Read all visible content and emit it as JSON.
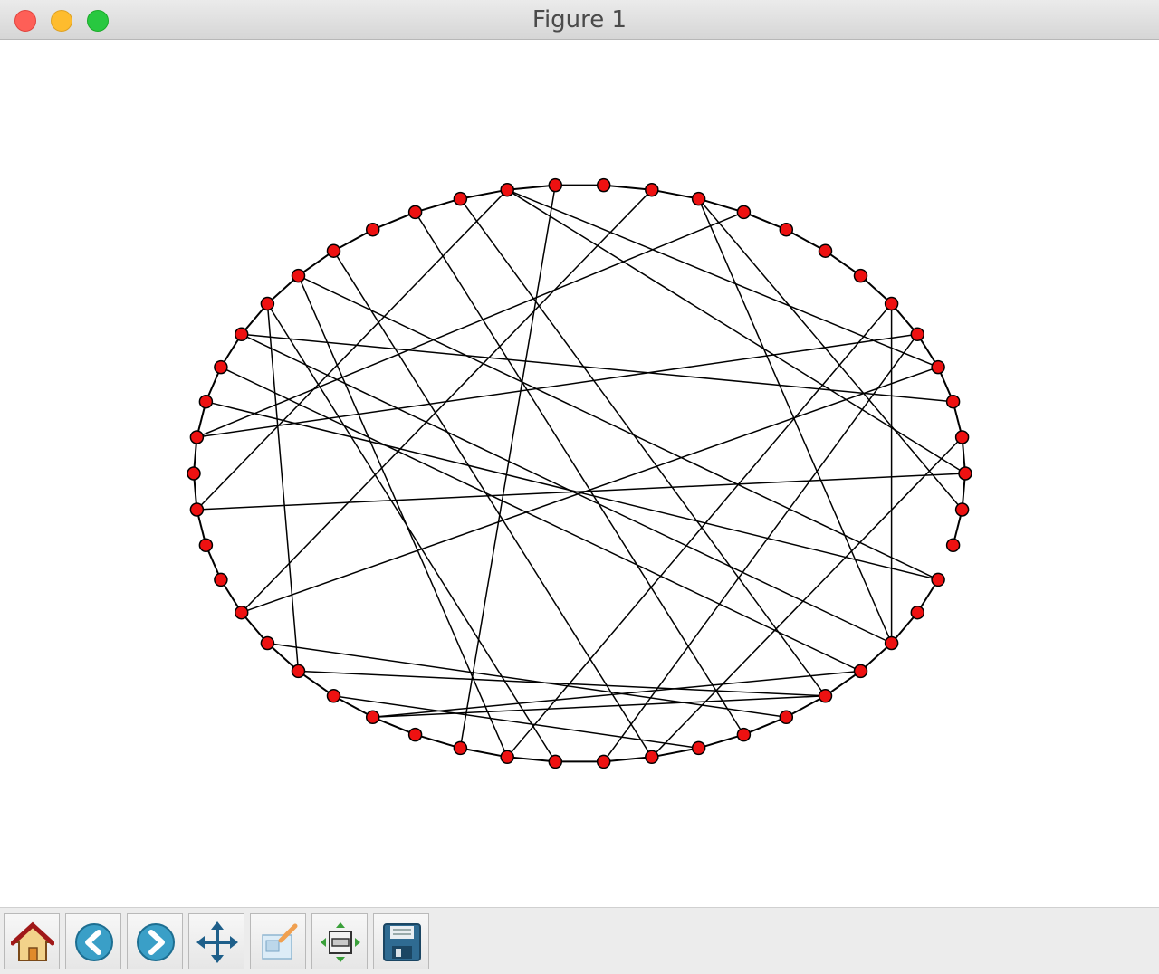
{
  "window": {
    "title": "Figure 1",
    "controls": [
      "close-icon",
      "minimize-icon",
      "maximize-icon"
    ]
  },
  "toolbar": {
    "buttons": [
      {
        "name": "home",
        "icon": "home-icon"
      },
      {
        "name": "back",
        "icon": "back-arrow-icon"
      },
      {
        "name": "forward",
        "icon": "forward-arrow-icon"
      },
      {
        "name": "pan",
        "icon": "pan-arrows-icon"
      },
      {
        "name": "zoom",
        "icon": "zoom-rect-icon"
      },
      {
        "name": "configure-subplots",
        "icon": "subplots-icon"
      },
      {
        "name": "save",
        "icon": "floppy-disk-icon"
      }
    ]
  },
  "colors": {
    "node_fill": "#ee1111",
    "node_stroke": "#000000",
    "edge": "#000000",
    "close": "#fe5f57",
    "minimize": "#febc2e",
    "maximize": "#28c840"
  },
  "graph": {
    "layout": "circular",
    "node_count": 50,
    "ring_edges": [
      [
        0,
        1
      ],
      [
        1,
        2
      ],
      [
        2,
        3
      ],
      [
        3,
        4
      ],
      [
        4,
        5
      ],
      [
        5,
        6
      ],
      [
        6,
        7
      ],
      [
        7,
        8
      ],
      [
        8,
        9
      ],
      [
        9,
        10
      ],
      [
        10,
        11
      ],
      [
        11,
        12
      ],
      [
        12,
        13
      ],
      [
        13,
        14
      ],
      [
        14,
        15
      ],
      [
        15,
        16
      ],
      [
        16,
        17
      ],
      [
        17,
        18
      ],
      [
        18,
        19
      ],
      [
        19,
        20
      ],
      [
        20,
        21
      ],
      [
        21,
        22
      ],
      [
        22,
        23
      ],
      [
        23,
        24
      ],
      [
        24,
        25
      ],
      [
        25,
        26
      ],
      [
        26,
        27
      ],
      [
        27,
        28
      ],
      [
        28,
        29
      ],
      [
        29,
        30
      ],
      [
        30,
        31
      ],
      [
        31,
        32
      ],
      [
        32,
        33
      ],
      [
        33,
        34
      ],
      [
        34,
        35
      ],
      [
        35,
        36
      ],
      [
        36,
        37
      ],
      [
        37,
        38
      ],
      [
        38,
        39
      ],
      [
        39,
        40
      ],
      [
        40,
        41
      ],
      [
        41,
        42
      ],
      [
        42,
        43
      ],
      [
        43,
        44
      ],
      [
        44,
        45
      ],
      [
        45,
        46
      ],
      [
        46,
        47
      ],
      [
        48,
        49
      ],
      [
        49,
        0
      ]
    ],
    "chord_edges": [
      [
        0,
        14
      ],
      [
        0,
        26
      ],
      [
        1,
        39
      ],
      [
        2,
        21
      ],
      [
        3,
        14
      ],
      [
        3,
        29
      ],
      [
        4,
        24
      ],
      [
        4,
        38
      ],
      [
        5,
        36
      ],
      [
        5,
        45
      ],
      [
        9,
        24
      ],
      [
        10,
        45
      ],
      [
        10,
        49
      ],
      [
        11,
        29
      ],
      [
        13,
        35
      ],
      [
        14,
        26
      ],
      [
        15,
        43
      ],
      [
        16,
        41
      ],
      [
        18,
        39
      ],
      [
        19,
        36
      ],
      [
        19,
        47
      ],
      [
        20,
        31
      ],
      [
        20,
        37
      ],
      [
        21,
        45
      ],
      [
        22,
        44
      ],
      [
        23,
        47
      ],
      [
        30,
        42
      ],
      [
        31,
        43
      ],
      [
        32,
        40
      ],
      [
        33,
        43
      ],
      [
        33,
        44
      ]
    ]
  }
}
